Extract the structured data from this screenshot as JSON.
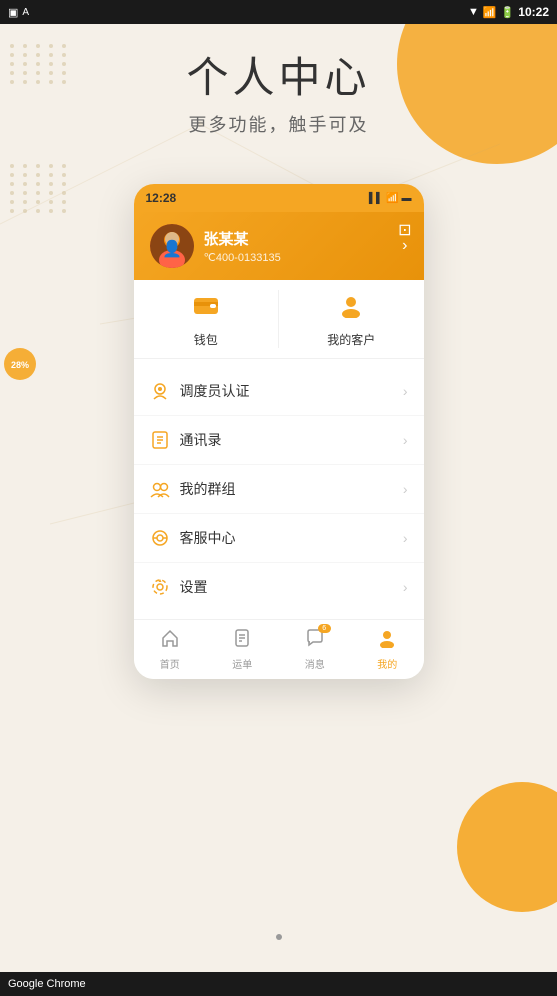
{
  "status_bar": {
    "time": "10:22",
    "app_icon": "A",
    "battery": "100"
  },
  "page": {
    "title": "个人中心",
    "subtitle": "更多功能，触手可及"
  },
  "phone": {
    "time": "12:28",
    "profile": {
      "name": "张某某",
      "phone": "℃400-0133135"
    },
    "quick_actions": [
      {
        "label": "钱包",
        "icon": "👛"
      },
      {
        "label": "我的客户",
        "icon": "👤"
      }
    ],
    "menu_items": [
      {
        "label": "调度员认证",
        "icon": "🔐"
      },
      {
        "label": "通讯录",
        "icon": "📱"
      },
      {
        "label": "我的群组",
        "icon": "👥"
      },
      {
        "label": "客服中心",
        "icon": "🎧"
      },
      {
        "label": "设置",
        "icon": "⚙"
      }
    ],
    "bottom_nav": [
      {
        "label": "首页",
        "icon": "🏠",
        "active": false
      },
      {
        "label": "运单",
        "icon": "📋",
        "active": false
      },
      {
        "label": "消息",
        "icon": "💬",
        "active": false,
        "badge": "6"
      },
      {
        "label": "我的",
        "icon": "👤",
        "active": true
      }
    ]
  },
  "progress": {
    "value": "28%"
  },
  "bottom_bar": {
    "label": "Google Chrome"
  }
}
